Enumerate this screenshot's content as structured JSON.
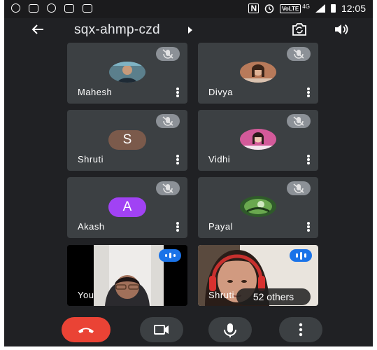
{
  "status_bar": {
    "volte": "VoLTE",
    "network": "4G",
    "time": "12:05"
  },
  "header": {
    "meeting_code": "sqx-ahmp-czd"
  },
  "participants": [
    {
      "name": "Mahesh",
      "muted": true
    },
    {
      "name": "Divya",
      "muted": true
    },
    {
      "name": "Shruti",
      "muted": true,
      "initial": "S",
      "avatar_color": "#7b5a4b"
    },
    {
      "name": "Vidhi",
      "muted": true
    },
    {
      "name": "Akash",
      "muted": true,
      "initial": "A",
      "avatar_color": "#a142f4"
    },
    {
      "name": "Payal",
      "muted": true
    }
  ],
  "video_tiles": [
    {
      "name": "You",
      "speaking": true
    },
    {
      "name": "Shruti",
      "speaking": true
    }
  ],
  "others_count_label": "52 others",
  "colors": {
    "background": "#202124",
    "tile": "#3c4043",
    "end_call": "#ea4335",
    "speaking_accent": "#1a73e8"
  }
}
